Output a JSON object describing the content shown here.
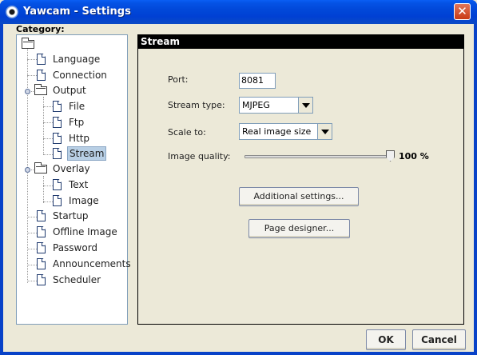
{
  "window": {
    "title": "Yawcam - Settings",
    "close_glyph": "✕"
  },
  "category_label": "Category:",
  "tree": {
    "items": [
      {
        "label": "Language",
        "icon": "document-icon"
      },
      {
        "label": "Connection",
        "icon": "document-icon"
      },
      {
        "label": "Output",
        "icon": "folder-icon"
      },
      {
        "label": "File",
        "icon": "document-icon"
      },
      {
        "label": "Ftp",
        "icon": "document-icon"
      },
      {
        "label": "Http",
        "icon": "document-icon"
      },
      {
        "label": "Stream",
        "icon": "document-icon",
        "selected": true
      },
      {
        "label": "Overlay",
        "icon": "folder-icon"
      },
      {
        "label": "Text",
        "icon": "document-icon"
      },
      {
        "label": "Image",
        "icon": "document-icon"
      },
      {
        "label": "Startup",
        "icon": "document-icon"
      },
      {
        "label": "Offline Image",
        "icon": "document-icon"
      },
      {
        "label": "Password",
        "icon": "document-icon"
      },
      {
        "label": "Announcements",
        "icon": "document-icon"
      },
      {
        "label": "Scheduler",
        "icon": "document-icon"
      }
    ]
  },
  "panel": {
    "title": "Stream",
    "port": {
      "label": "Port:",
      "value": "8081"
    },
    "stream_type": {
      "label": "Stream type:",
      "value": "MJPEG"
    },
    "scale_to": {
      "label": "Scale to:",
      "value": "Real image size"
    },
    "image_quality": {
      "label": "Image quality:",
      "value_text": "100 %",
      "value": 100
    },
    "additional_settings": "Additional settings...",
    "page_designer": "Page designer..."
  },
  "buttons": {
    "ok": "OK",
    "cancel": "Cancel"
  }
}
